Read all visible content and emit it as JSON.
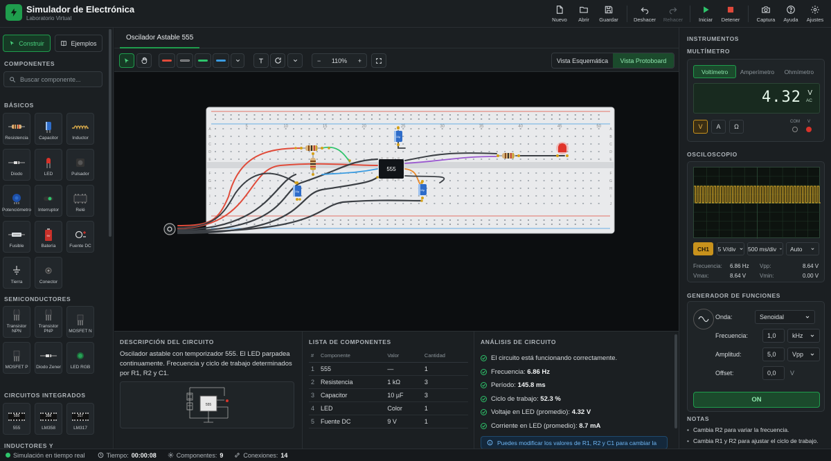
{
  "app": {
    "title": "Simulador de Electrónica",
    "subtitle": "Laboratorio Virtual"
  },
  "header_buttons": {
    "nuevo": "Nuevo",
    "abrir": "Abrir",
    "guardar": "Guardar",
    "deshacer": "Deshacer",
    "rehacer": "Rehacer",
    "iniciar": "Iniciar",
    "detener": "Detener",
    "captura": "Captura",
    "ayuda": "Ayuda",
    "ajustes": "Ajustes"
  },
  "sidebar": {
    "mode_construir": "Construir",
    "mode_ejemplos": "Ejemplos",
    "components_label": "COMPONENTES",
    "search_placeholder": "Buscar componente...",
    "basicos_label": "BÁSICOS",
    "basicos": [
      "Resistencia",
      "Capacitor",
      "Inductor",
      "Diodo",
      "LED",
      "Pulsador",
      "Potenciómetro",
      "Interruptor",
      "Relé",
      "Fusible",
      "Batería",
      "Fuente DC",
      "Tierra",
      "Conector"
    ],
    "semiconductores_label": "SEMICONDUCTORES",
    "semiconductores": [
      "Transistor NPN",
      "Transistor PNP",
      "MOSFET N",
      "MOSFET P",
      "Diodo Zener",
      "LED RGB"
    ],
    "ic_label": "CIRCUITOS INTEGRADOS",
    "ics": [
      "555",
      "LM358",
      "LM317"
    ],
    "ic_chip_labels": [
      "555",
      "358",
      "317"
    ],
    "inductores_label": "INDUCTORES Y"
  },
  "tab": {
    "label": "Oscilador Astable 555"
  },
  "toolbar": {
    "zoom": "110%",
    "zoom_minus": "−",
    "zoom_plus": "+",
    "view_schematic": "Vista Esquemática",
    "view_protoboard": "Vista Protoboard"
  },
  "canvas": {
    "column_numbers": [
      "5",
      "10",
      "15",
      "20",
      "25",
      "30",
      "35",
      "40",
      "45",
      "50"
    ],
    "row_letters_top": [
      "A",
      "B",
      "C",
      "D",
      "E"
    ],
    "row_letters_bottom": [
      "F",
      "G",
      "H",
      "I",
      "J"
    ],
    "ic_label": "555",
    "cap_label": "10µ"
  },
  "description": {
    "title": "DESCRIPCIÓN DEL CIRCUITO",
    "text": "Oscilador astable con temporizador 555. El LED parpadea continuamente. Frecuencia y ciclo de trabajo determinados por R1, R2 y C1.",
    "chip": "555"
  },
  "components_list": {
    "title": "LISTA DE COMPONENTES",
    "headers": [
      "#",
      "Componente",
      "Valor",
      "Cantidad"
    ],
    "rows": [
      [
        "1",
        "555",
        "—",
        "1"
      ],
      [
        "2",
        "Resistencia",
        "1 kΩ",
        "3"
      ],
      [
        "3",
        "Capacitor",
        "10 µF",
        "3"
      ],
      [
        "4",
        "LED",
        "Color",
        "1"
      ],
      [
        "5",
        "Fuente DC",
        "9 V",
        "1"
      ]
    ]
  },
  "analysis": {
    "title": "ANÁLISIS DE CIRCUITO",
    "status": "El circuito está funcionando correctamente.",
    "rows": [
      {
        "label": "Frecuencia: ",
        "value": "6.86 Hz"
      },
      {
        "label": "Período: ",
        "value": "145.8 ms"
      },
      {
        "label": "Ciclo de trabajo: ",
        "value": "52.3 %"
      },
      {
        "label": "Voltaje en LED (promedio): ",
        "value": "4.32 V"
      },
      {
        "label": "Corriente en LED (promedio): ",
        "value": "8.7 mA"
      }
    ],
    "info": "Puedes modificar los valores de R1, R2 y C1 para cambiar la"
  },
  "instruments": {
    "title": "INSTRUMENTOS",
    "multimeter": {
      "title": "MULTÍMETRO",
      "tabs": [
        "Voltímetro",
        "Amperímetro",
        "Ohmímetro"
      ],
      "value": "4.32",
      "unit": "V",
      "unit_sub": "AC",
      "buttons": [
        "V",
        "A",
        "Ω"
      ],
      "jack_com": "COM",
      "jack_v": "V"
    },
    "oscilloscope": {
      "title": "OSCILOSCOPIO",
      "channel": "CH1",
      "vdiv": "5 V/div",
      "timediv": "500 ms/div",
      "trigger": "Auto",
      "measurements": {
        "freq_label": "Frecuencia:",
        "freq": "6.86 Hz",
        "vpp_label": "Vpp:",
        "vpp": "8.64 V",
        "vmax_label": "Vmax:",
        "vmax": "8.64 V",
        "vmin_label": "Vmin:",
        "vmin": "0.00 V"
      }
    },
    "function_generator": {
      "title": "GENERADOR DE FUNCIONES",
      "onda_label": "Onda:",
      "onda": "Senoidal",
      "freq_label": "Frecuencia:",
      "freq": "1,0",
      "freq_unit": "kHz",
      "amp_label": "Amplitud:",
      "amp": "5,0",
      "amp_unit": "Vpp",
      "offset_label": "Offset:",
      "offset": "0,0",
      "offset_unit": "V",
      "on": "ON"
    },
    "notes": {
      "title": "NOTAS",
      "items": [
        "Cambia R2 para variar la frecuencia.",
        "Cambia R1 y R2 para ajustar el ciclo de trabajo."
      ]
    }
  },
  "status": {
    "sim": "Simulación en tiempo real",
    "time_label": "Tiempo:",
    "time": "00:00:08",
    "comp_label": "Componentes:",
    "comp": "9",
    "conn_label": "Conexiones:",
    "conn": "14"
  },
  "colors": {
    "accent": "#1f9d4d",
    "scope_trace": "#e8b52a",
    "wire_red": "#e04b3a",
    "wire_green": "#2ec46b",
    "wire_blue": "#3a9be0",
    "wire_purple": "#9b59d0",
    "wire_orange": "#e98a2c"
  }
}
